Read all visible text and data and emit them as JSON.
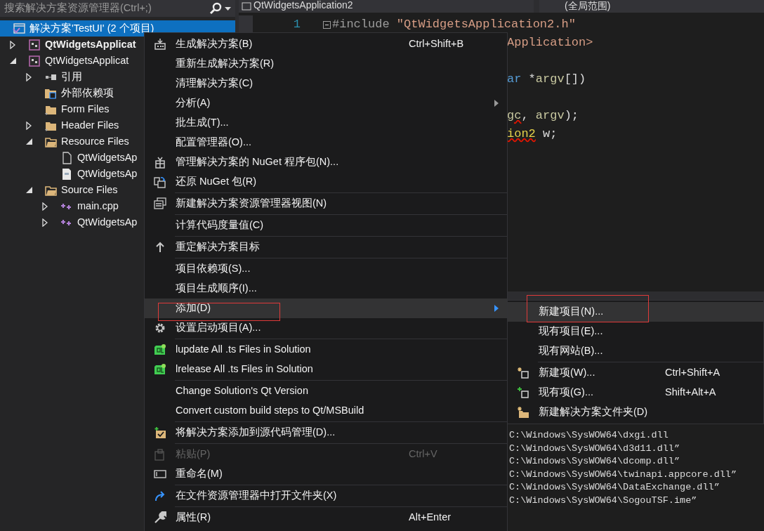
{
  "solution_explorer": {
    "search": {
      "placeholder": "搜索解决方案资源管理器(Ctrl+;)"
    },
    "tree": [
      {
        "label": "解决方案'TestUI' (2 个项目)",
        "kind": "solution",
        "selected": true,
        "bold": false,
        "children": [
          {
            "label": "QtWidgetsApplicat",
            "kind": "project",
            "selected": false,
            "bold": true,
            "expanded": false
          },
          {
            "label": "QtWidgetsApplicat",
            "kind": "project",
            "selected": false,
            "bold": false,
            "expanded": true,
            "children": [
              {
                "label": "引用",
                "kind": "references",
                "selected": false,
                "bold": false,
                "expanded": false
              },
              {
                "label": "外部依赖项",
                "kind": "external",
                "selected": false,
                "bold": false
              },
              {
                "label": "Form Files",
                "kind": "folder",
                "selected": false,
                "bold": false
              },
              {
                "label": "Header Files",
                "kind": "folder",
                "selected": false,
                "bold": false,
                "expanded": false
              },
              {
                "label": "Resource Files",
                "kind": "filter",
                "selected": false,
                "bold": false,
                "expanded": true,
                "children": [
                  {
                    "label": "QtWidgetsAp",
                    "kind": "file",
                    "selected": false,
                    "bold": false
                  },
                  {
                    "label": "QtWidgetsAp",
                    "kind": "form",
                    "selected": false,
                    "bold": false
                  }
                ]
              },
              {
                "label": "Source Files",
                "kind": "filter",
                "selected": false,
                "bold": false,
                "expanded": true,
                "children": [
                  {
                    "label": "main.cpp",
                    "kind": "cpp",
                    "selected": false,
                    "bold": false,
                    "expanded": false
                  },
                  {
                    "label": "QtWidgetsAp",
                    "kind": "cpp",
                    "selected": false,
                    "bold": false,
                    "expanded": false
                  }
                ]
              }
            ]
          }
        ]
      }
    ]
  },
  "editor": {
    "file_dropdown": "QtWidgetsApplication2",
    "scope_dropdown": "(全局范围)",
    "lines": [
      {
        "number": "1",
        "partial": false,
        "spaced": false,
        "collapsible": true,
        "tokens": [
          {
            "text": "#include",
            "kind": "preprocessor",
            "error": false
          },
          {
            "text": " \"QtWidgetsApplication2.h\"",
            "kind": "string",
            "error": false
          }
        ]
      },
      {
        "partial": true,
        "spaced": false,
        "tokens": [
          {
            "text": "Application>",
            "kind": "string",
            "error": false
          }
        ]
      },
      {
        "partial": true,
        "spaced": true,
        "tokens": [
          {
            "text": "ar",
            "kind": "keyword",
            "error": false
          },
          {
            "text": " *",
            "kind": "plain",
            "error": false
          },
          {
            "text": "argv",
            "kind": "param",
            "error": false
          },
          {
            "text": "[])",
            "kind": "plain",
            "error": false
          }
        ]
      },
      {
        "partial": true,
        "spaced": true,
        "tokens": [
          {
            "text": "gc",
            "kind": "param",
            "error": true
          },
          {
            "text": ", ",
            "kind": "plain",
            "error": false
          },
          {
            "text": "argv",
            "kind": "param",
            "error": false
          },
          {
            "text": ");",
            "kind": "plain",
            "error": false
          }
        ]
      },
      {
        "partial": true,
        "spaced": false,
        "tokens": [
          {
            "text": "ion2",
            "kind": "type",
            "error": true
          },
          {
            "text": " w;",
            "kind": "plain",
            "error": false
          }
        ]
      }
    ]
  },
  "output": {
    "lines": [
      "C:\\Windows\\SysWOW64\\dxgi.dll",
      "C:\\Windows\\SysWOW64\\d3d11.dll”",
      "C:\\Windows\\SysWOW64\\dcomp.dll”",
      "C:\\Windows\\SysWOW64\\twinapi.appcore.dll”",
      "C:\\Windows\\SysWOW64\\DataExchange.dll”",
      "C:\\Windows\\SysWOW64\\SogouTSF.ime”"
    ]
  },
  "context_menu": {
    "items": [
      {
        "label": "生成解决方案(B)",
        "shortcut": "Ctrl+Shift+B",
        "kind": "build",
        "has_submenu": false,
        "disabled": false,
        "highlighted": false
      },
      {
        "label": "重新生成解决方案(R)",
        "kind": "plain",
        "has_submenu": false,
        "disabled": false,
        "highlighted": false
      },
      {
        "label": "清理解决方案(C)",
        "kind": "plain",
        "has_submenu": false,
        "disabled": false,
        "highlighted": false
      },
      {
        "label": "分析(A)",
        "kind": "plain",
        "has_submenu": true,
        "disabled": false,
        "highlighted": false
      },
      {
        "label": "批生成(T)...",
        "kind": "plain",
        "has_submenu": false,
        "disabled": false,
        "highlighted": false
      },
      {
        "label": "配置管理器(O)...",
        "kind": "plain",
        "has_submenu": false,
        "disabled": false,
        "highlighted": false
      },
      {
        "label": "管理解决方案的 NuGet 程序包(N)...",
        "kind": "gift",
        "has_submenu": false,
        "disabled": false,
        "highlighted": false
      },
      {
        "label": "还原 NuGet 包(R)",
        "kind": "restore",
        "has_submenu": false,
        "disabled": false,
        "highlighted": false
      },
      {
        "label": "新建解决方案资源管理器视图(N)",
        "kind": "windows",
        "has_submenu": false,
        "disabled": false,
        "highlighted": false,
        "divider_above": true
      },
      {
        "label": "计算代码度量值(C)",
        "kind": "plain",
        "has_submenu": false,
        "disabled": false,
        "highlighted": false,
        "divider_above": true
      },
      {
        "label": "重定解决方案目标",
        "kind": "retarget",
        "has_submenu": false,
        "disabled": false,
        "highlighted": false,
        "divider_above": true
      },
      {
        "label": "项目依赖项(S)...",
        "kind": "plain",
        "has_submenu": false,
        "disabled": false,
        "highlighted": false,
        "divider_above": true
      },
      {
        "label": "项目生成顺序(I)...",
        "kind": "plain",
        "has_submenu": false,
        "disabled": false,
        "highlighted": false
      },
      {
        "label": "添加(D)",
        "kind": "plain",
        "has_submenu": true,
        "disabled": false,
        "highlighted": true,
        "outlined": true
      },
      {
        "label": "设置启动项目(A)...",
        "kind": "settings",
        "has_submenu": false,
        "disabled": false,
        "highlighted": false
      },
      {
        "label": "lupdate All .ts Files in Solution",
        "kind": "qt",
        "has_submenu": false,
        "disabled": false,
        "highlighted": false,
        "divider_above": true
      },
      {
        "label": "lrelease All .ts Files in Solution",
        "kind": "qt",
        "has_submenu": false,
        "disabled": false,
        "highlighted": false
      },
      {
        "label": "Change Solution's Qt Version",
        "kind": "plain",
        "has_submenu": false,
        "disabled": false,
        "highlighted": false,
        "divider_above": true
      },
      {
        "label": "Convert custom build steps to Qt/MSBuild",
        "kind": "plain",
        "has_submenu": false,
        "disabled": false,
        "highlighted": false
      },
      {
        "label": "将解决方案添加到源代码管理(D)...",
        "kind": "vcs",
        "has_submenu": false,
        "disabled": false,
        "highlighted": false,
        "divider_above": true
      },
      {
        "label": "粘贴(P)",
        "shortcut": "Ctrl+V",
        "kind": "paste",
        "has_submenu": false,
        "disabled": true,
        "highlighted": false,
        "divider_above": true
      },
      {
        "label": "重命名(M)",
        "kind": "rename",
        "has_submenu": false,
        "disabled": false,
        "highlighted": false
      },
      {
        "label": "在文件资源管理器中打开文件夹(X)",
        "kind": "open",
        "has_submenu": false,
        "disabled": false,
        "highlighted": false,
        "divider_above": true
      },
      {
        "label": "属性(R)",
        "shortcut": "Alt+Enter",
        "kind": "properties",
        "has_submenu": false,
        "disabled": false,
        "highlighted": false,
        "divider_above": true
      }
    ]
  },
  "submenu": {
    "items": [
      {
        "label": "新建项目(N)...",
        "kind": "plain",
        "has_submenu": false,
        "disabled": false,
        "highlighted": true,
        "outlined": true
      },
      {
        "label": "现有项目(E)...",
        "kind": "plain",
        "has_submenu": false,
        "disabled": false,
        "highlighted": false
      },
      {
        "label": "现有网站(B)...",
        "kind": "plain",
        "has_submenu": false,
        "disabled": false,
        "highlighted": false
      },
      {
        "label": "新建项(W)...",
        "shortcut": "Ctrl+Shift+A",
        "kind": "newitem",
        "has_submenu": false,
        "disabled": false,
        "highlighted": false,
        "divider_above": true
      },
      {
        "label": "现有项(G)...",
        "shortcut": "Shift+Alt+A",
        "kind": "additem",
        "has_submenu": false,
        "disabled": false,
        "highlighted": false
      },
      {
        "label": "新建解决方案文件夹(D)",
        "kind": "newfolder",
        "has_submenu": false,
        "disabled": false,
        "highlighted": false
      }
    ]
  }
}
